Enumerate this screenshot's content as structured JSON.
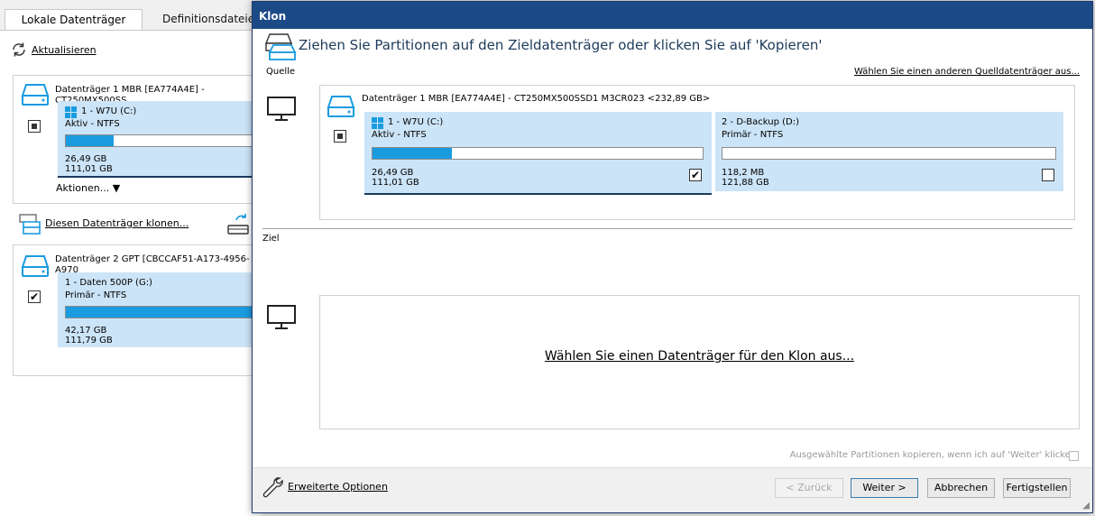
{
  "background": {
    "tabs": [
      {
        "label": "Lokale Datenträger",
        "active": true
      },
      {
        "label": "Definitionsdateien",
        "active": false
      }
    ],
    "refresh_label": "Aktualisieren",
    "disk1": {
      "title": "Datenträger 1 MBR [EA774A4E] - CT250MX500SS",
      "partition": {
        "name": "1 - W7U (C:)",
        "type": "Aktiv - NTFS",
        "used": "26,49 GB",
        "total": "111,01 GB",
        "fill": 0.24
      },
      "actions_label": "Aktionen..."
    },
    "clone_link": "Diesen Datenträger klonen...",
    "disk2": {
      "title": "Datenträger 2 GPT [CBCCAF51-A173-4956-A970",
      "partition": {
        "name": "1 - Daten 500P (G:)",
        "type": "Primär - NTFS",
        "used": "42,17 GB",
        "total": "111,79 GB",
        "fill": 1.0
      }
    }
  },
  "dialog": {
    "title": "Klon",
    "heading": "Ziehen Sie Partitionen auf den Zieldatenträger oder klicken Sie auf 'Kopieren'",
    "source_label": "Quelle",
    "choose_other_source": "Wählen Sie einen anderen Quelldatenträger aus...",
    "source_disk": {
      "title": "Datenträger 1 MBR [EA774A4E] - CT250MX500SSD1 M3CR023  <232,89 GB>",
      "partitions": [
        {
          "name": "1 - W7U (C:)",
          "type": "Aktiv - NTFS",
          "used": "26,49 GB",
          "total": "111,01 GB",
          "fill": 0.24,
          "checked": true
        },
        {
          "name": "2 - D-Backup (D:)",
          "type": "Primär - NTFS",
          "used": "118,2 MB",
          "total": "121,88 GB",
          "fill": 0.0,
          "checked": false
        }
      ]
    },
    "target_label": "Ziel",
    "choose_target": "Wählen Sie einen Datenträger für den Klon aus...",
    "copy_option": "Ausgewählte Partitionen kopieren, wenn ich auf 'Weiter' klicke.",
    "advanced_options": "Erweiterte Optionen",
    "buttons": {
      "back": "< Zurück",
      "next": "Weiter >",
      "cancel": "Abbrechen",
      "finish": "Fertigstellen"
    }
  },
  "colors": {
    "title_bar": "#1c4a86",
    "partition_bg": "#cce4f7",
    "usage_fill": "#1a9be0",
    "disk_icon": "#1a9be0"
  }
}
